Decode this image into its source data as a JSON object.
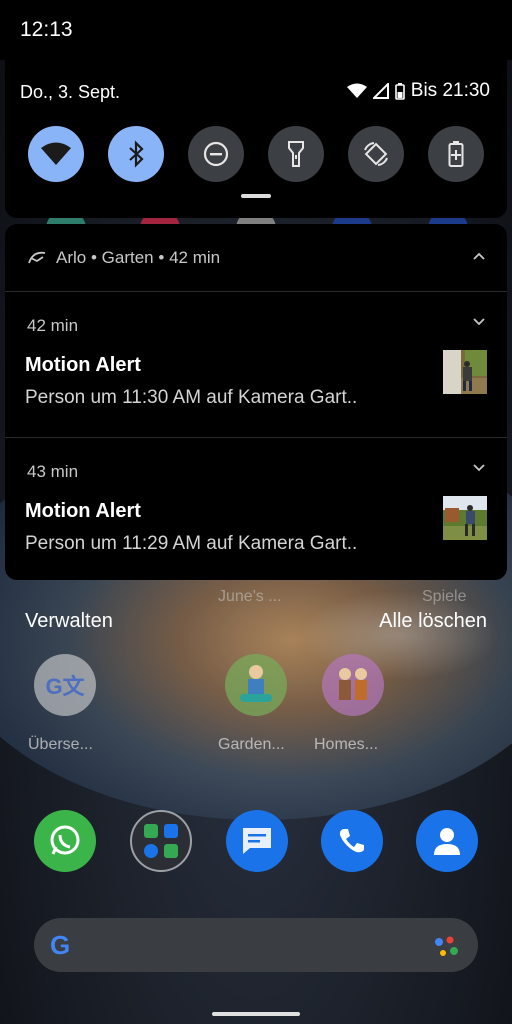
{
  "status_bar": {
    "time": "12:13"
  },
  "quick_settings": {
    "date": "Do., 3. Sept.",
    "battery_text": "Bis 21:30",
    "tiles": [
      {
        "name": "wifi",
        "state": "on"
      },
      {
        "name": "bluetooth",
        "state": "on"
      },
      {
        "name": "do-not-disturb",
        "state": "off"
      },
      {
        "name": "flashlight",
        "state": "off"
      },
      {
        "name": "auto-rotate",
        "state": "off"
      },
      {
        "name": "battery-saver",
        "state": "off"
      }
    ]
  },
  "notification_group": {
    "app": "Arlo",
    "channel": "Garten",
    "age": "42 min",
    "header_separator": "•",
    "items": [
      {
        "time": "42 min",
        "title": "Motion Alert",
        "body": "Person um 11:30 AM auf Kamera Gart.."
      },
      {
        "time": "43 min",
        "title": "Motion Alert",
        "body": "Person um 11:29 AM auf Kamera Gart.."
      }
    ]
  },
  "actions": {
    "manage": "Verwalten",
    "clear_all": "Alle löschen"
  },
  "behind_labels": {
    "left": "June's ...",
    "right": "Spiele"
  },
  "home_apps": [
    {
      "label": "Überse...",
      "icon": "translate-icon"
    },
    {
      "label": "Garden...",
      "icon": "garden-icon"
    },
    {
      "label": "Homes...",
      "icon": "homescapes-icon"
    }
  ],
  "dock": [
    {
      "name": "whatsapp",
      "icon": "whatsapp-icon"
    },
    {
      "name": "app-folder",
      "icon": "folder-icon"
    },
    {
      "name": "messages",
      "icon": "messages-icon"
    },
    {
      "name": "phone",
      "icon": "phone-icon"
    },
    {
      "name": "contacts",
      "icon": "contacts-icon"
    }
  ],
  "colors": {
    "tile_on": "#8ab4f8",
    "tile_off": "#3c3f43",
    "whatsapp": "#25d366",
    "dock_blue": "#1a73e8"
  }
}
